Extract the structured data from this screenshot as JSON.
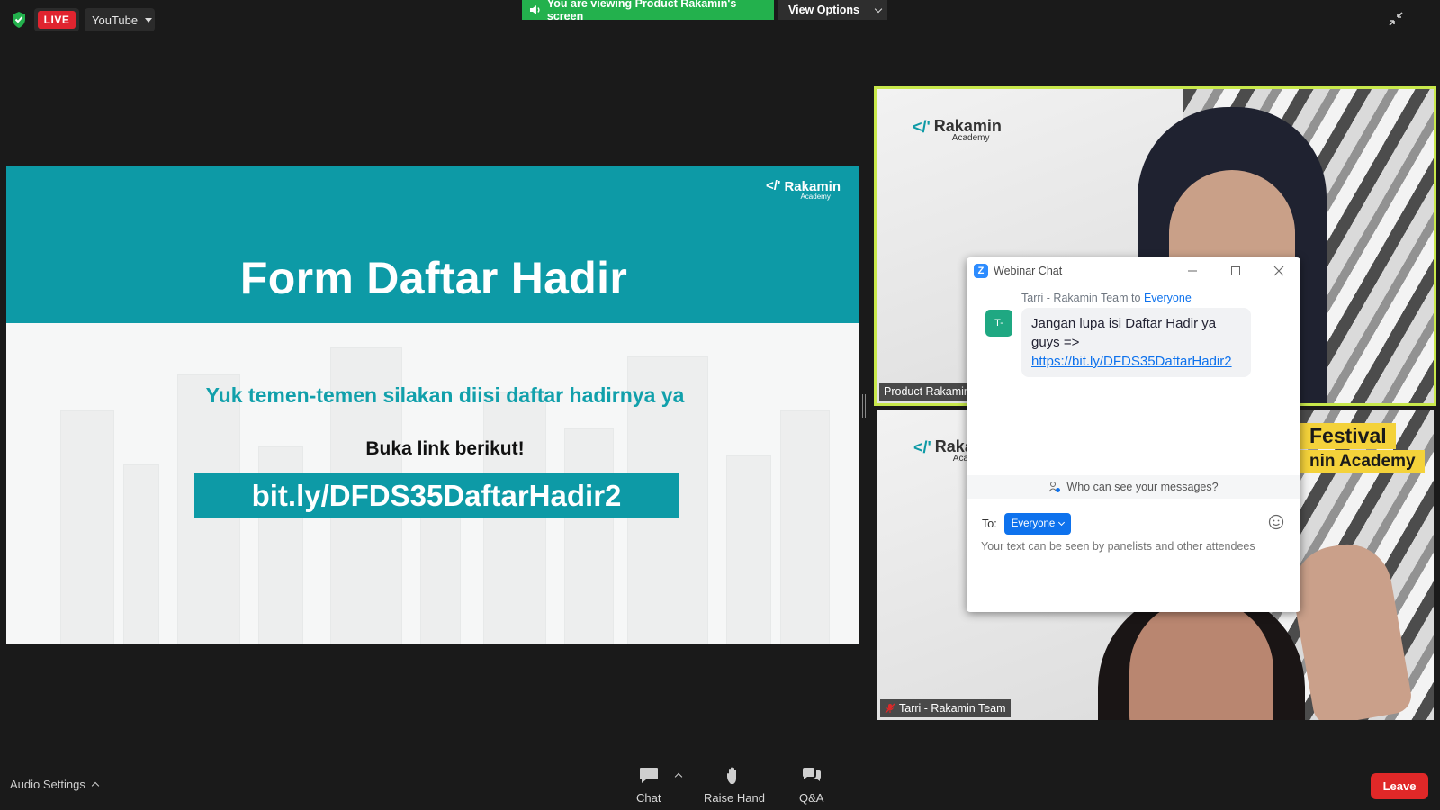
{
  "topbar": {
    "live_label": "LIVE",
    "stream_target": "YouTube",
    "viewing_banner": "You are viewing Product Rakamin's screen",
    "view_options_label": "View Options"
  },
  "slide": {
    "logo_name": "Rakamin",
    "logo_sub": "Academy",
    "title": "Form Daftar Hadir",
    "subtitle": "Yuk temen-temen silakan diisi daftar hadirnya ya",
    "buka_text": "Buka link berikut!",
    "link_text": "bit.ly/DFDS35DaftarHadir2",
    "colors": {
      "teal": "#0d9aa6",
      "subtitle": "#11a0ab"
    }
  },
  "videos": [
    {
      "name": "Product Rakamin",
      "logo_name": "Rakamin",
      "logo_sub": "Academy",
      "active_speaker": true
    },
    {
      "name": "Tarri - Rakamin Team",
      "logo_name": "Raka",
      "logo_sub": "Acade",
      "muted": true,
      "banner_line1": "Festival",
      "banner_line2": "nin Academy"
    }
  ],
  "chat": {
    "window_title": "Webinar Chat",
    "message": {
      "sender": "Tarri - Rakamin Team",
      "to_word": "to",
      "recipient": "Everyone",
      "avatar_initials": "T-",
      "text": "Jangan lupa isi Daftar Hadir ya guys =>",
      "link": "https://bit.ly/DFDS35DaftarHadir2"
    },
    "visibility_prompt": "Who can see your messages?",
    "to_label": "To:",
    "to_value": "Everyone",
    "input_placeholder": "Your text can be seen by panelists and other attendees"
  },
  "bottombar": {
    "audio_settings": "Audio Settings",
    "buttons": [
      {
        "label": "Chat",
        "icon": "chat-icon"
      },
      {
        "label": "Raise Hand",
        "icon": "hand-icon"
      },
      {
        "label": "Q&A",
        "icon": "qa-icon"
      }
    ],
    "leave_label": "Leave"
  }
}
